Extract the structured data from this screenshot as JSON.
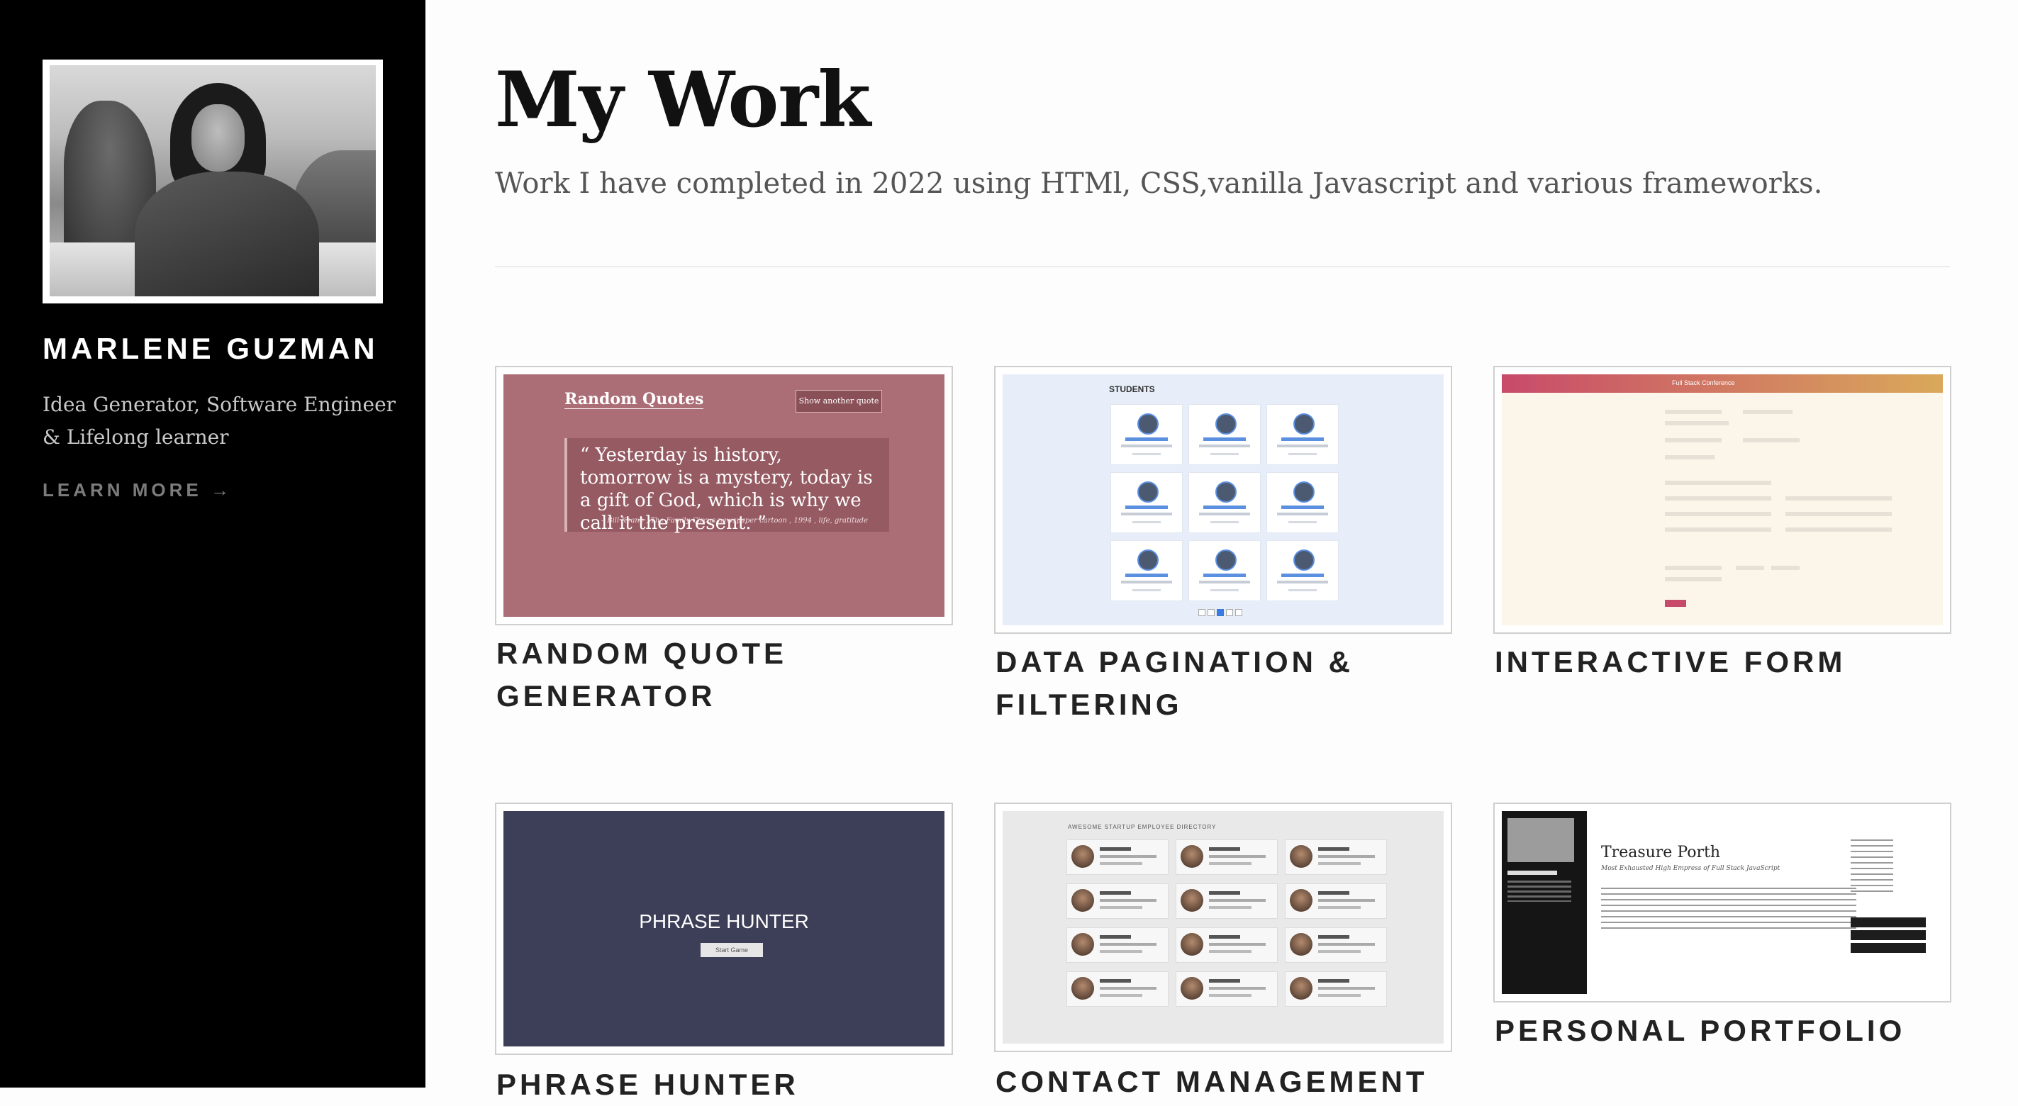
{
  "sidebar": {
    "name": "MARLENE GUZMAN",
    "tagline": "Idea Generator, Software Engineer & Lifelong learner",
    "learn_more": "LEARN MORE →"
  },
  "main": {
    "title": "My Work",
    "subtitle": "Work I have completed in 2022 using HTMl, CSS,vanilla Javascript and various frameworks."
  },
  "projects": [
    {
      "title": "RANDOM QUOTE GENERATOR",
      "thumb": {
        "heading": "Random Quotes",
        "button": "Show another quote",
        "quote": "“ Yesterday is history, tomorrow is a mystery, today is a gift of God, which is why we call it the present. ”",
        "citation": "– Bill Keane , The Family Circus newspaper cartoon , 1994 , life, gratitude"
      }
    },
    {
      "title": "DATA PAGINATION & FILTERING",
      "thumb": {
        "heading": "STUDENTS"
      }
    },
    {
      "title": "INTERACTIVE FORM",
      "thumb": {
        "heading": "Full Stack Conference"
      }
    },
    {
      "title": "PHRASE HUNTER",
      "thumb": {
        "heading": "PHRASE HUNTER",
        "button": "Start Game"
      }
    },
    {
      "title": "CONTACT MANAGEMENT",
      "thumb": {
        "heading": "AWESOME STARTUP EMPLOYEE DIRECTORY"
      }
    },
    {
      "title": "PERSONAL PORTFOLIO",
      "thumb": {
        "heading": "Treasure Porth",
        "subheading": "Most Exhausted High Empress of Full Stack JavaScript"
      }
    }
  ]
}
